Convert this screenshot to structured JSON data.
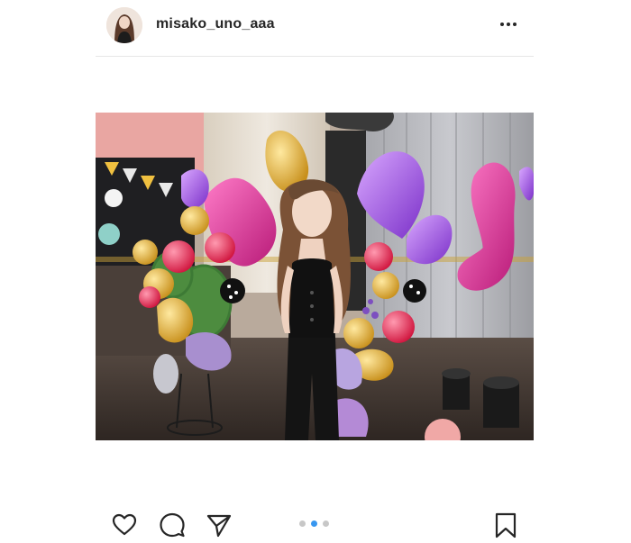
{
  "post": {
    "username": "misako_uno_aaa",
    "menu_icon": "more-horizontal-icon"
  },
  "actions": {
    "icons": [
      "heart-icon",
      "comment-icon",
      "share-icon",
      "bookmark-icon"
    ]
  },
  "carousel": {
    "total": 3,
    "active_index": 1,
    "active_color": "#3897f0",
    "inactive_color": "#c7c7c7"
  }
}
